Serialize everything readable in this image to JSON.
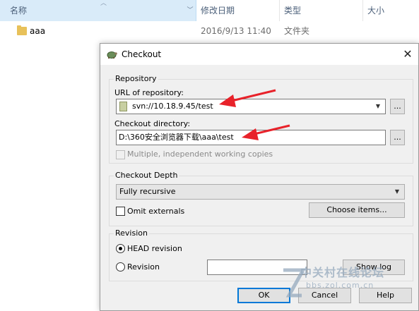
{
  "explorer": {
    "columns": {
      "name": "名称",
      "date": "修改日期",
      "type": "类型",
      "size": "大小"
    },
    "files": [
      {
        "name": "aaa",
        "date": "2016/9/13 11:40",
        "type": "文件夹"
      }
    ]
  },
  "dialog": {
    "title": "Checkout",
    "repository": {
      "legend": "Repository",
      "url_label": "URL of repository:",
      "url_value": "svn://10.18.9.45/test",
      "dir_label": "Checkout directory:",
      "dir_value": "D:\\360安全浏览器下载\\aaa\\test",
      "browse_label": "...",
      "multiple_label": "Multiple, independent working copies"
    },
    "depth": {
      "legend": "Checkout Depth",
      "selected": "Fully recursive",
      "omit_label": "Omit externals",
      "choose_label": "Choose items..."
    },
    "revision": {
      "legend": "Revision",
      "head_label": "HEAD revision",
      "revision_label": "Revision",
      "revision_value": "",
      "show_log_label": "Show log"
    },
    "buttons": {
      "ok": "OK",
      "cancel": "Cancel",
      "help": "Help"
    }
  },
  "watermark": {
    "line1": "中关村在线论坛",
    "line2": "bbs.zol.com.cn"
  },
  "colors": {
    "accent": "#0078d7",
    "arrow": "#e8222a",
    "header_selected": "#d9ebf9"
  }
}
